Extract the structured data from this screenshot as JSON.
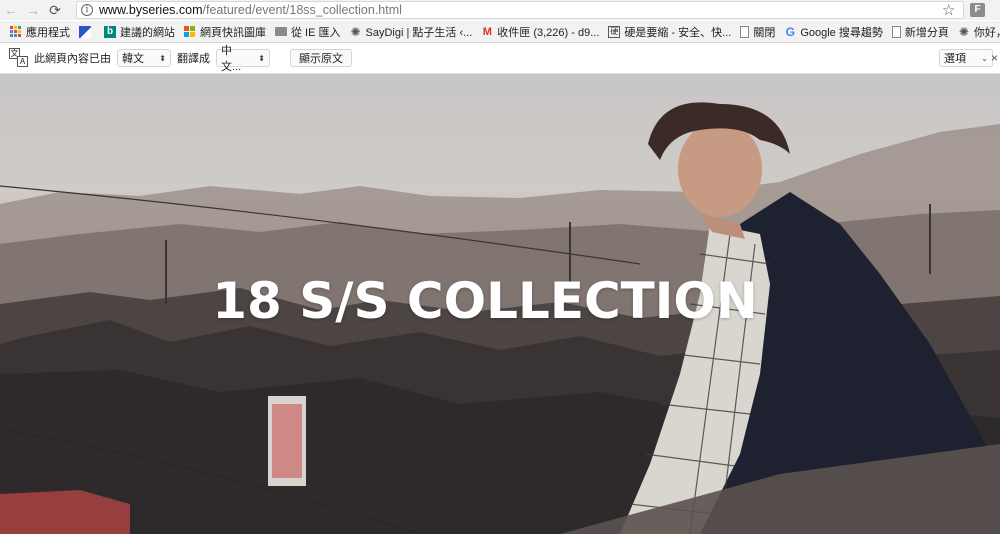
{
  "browser": {
    "url_host": "www.byseries.com",
    "url_path": "/featured/event/18ss_collection.html",
    "extension_letter": "F"
  },
  "bookmarks": [
    {
      "label": "應用程式",
      "icon": "apps-icon"
    },
    {
      "label": "",
      "icon": "blue-flag-icon"
    },
    {
      "label": "建議的網站",
      "icon": "bing-icon"
    },
    {
      "label": "網頁快訊圖庫",
      "icon": "microsoft-icon"
    },
    {
      "label": "從 IE 匯入",
      "icon": "folder-icon"
    },
    {
      "label": "SayDigi | 點子生活 ‹...",
      "icon": "sun-icon"
    },
    {
      "label": "收件匣 (3,226) - d9...",
      "icon": "gmail-icon"
    },
    {
      "label": "硬是要縮 - 安全、快...",
      "icon": "hard-icon"
    },
    {
      "label": "關閉",
      "icon": "document-icon"
    },
    {
      "label": "Google 搜尋趨勢",
      "icon": "google-icon"
    },
    {
      "label": "新增分頁",
      "icon": "document-icon"
    },
    {
      "label": "你好，Daphne",
      "icon": "sun-icon"
    }
  ],
  "translate_bar": {
    "prefix": "此網頁內容已由",
    "source_lang": "韓文",
    "middle": "翻譯成",
    "target_lang": "中文...",
    "show_original": "顯示原文",
    "options": "選項"
  },
  "hero": {
    "title": "18 S/S COLLECTION"
  }
}
